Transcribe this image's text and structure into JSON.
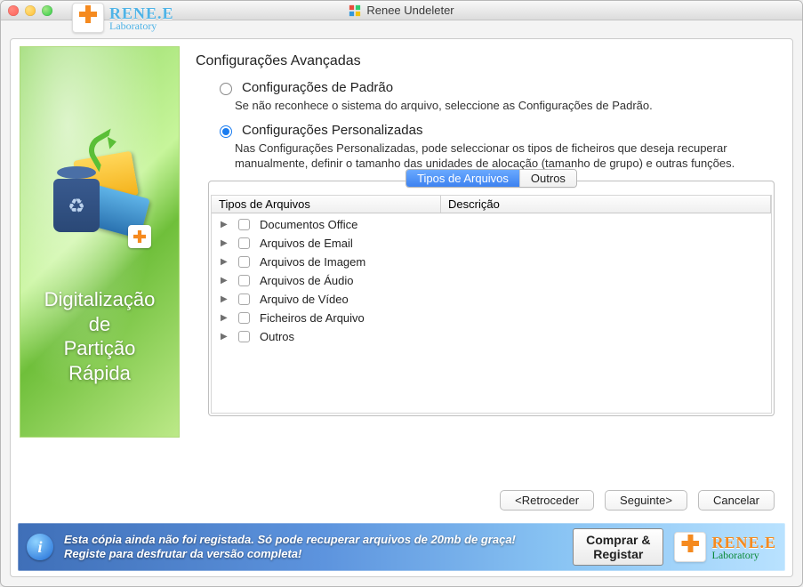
{
  "window": {
    "title": "Renee Undeleter"
  },
  "brand": {
    "name": "RENE.E",
    "sub": "Laboratory"
  },
  "sidebar": {
    "text": "Digitalização\nde\nPartição\nRápida"
  },
  "main": {
    "title": "Configurações Avançadas",
    "opt_default": {
      "label": "Configurações de Padrão",
      "desc": "Se não reconhece o sistema do arquivo, seleccione as Configurações de Padrão."
    },
    "opt_custom": {
      "label": "Configurações Personalizadas",
      "desc": "Nas Configurações Personalizadas, pode seleccionar os tipos de ficheiros que deseja recuperar manualmente, definir o tamanho das unidades de alocação (tamanho de grupo) e outras funções."
    },
    "tabs": {
      "types": "Tipos de Arquivos",
      "others": "Outros"
    },
    "columns": {
      "type": "Tipos de Arquivos",
      "desc": "Descrição"
    },
    "rows": [
      {
        "label": "Documentos Office"
      },
      {
        "label": "Arquivos de Email"
      },
      {
        "label": "Arquivos de Imagem"
      },
      {
        "label": "Arquivos de Áudio"
      },
      {
        "label": "Arquivo de Vídeo"
      },
      {
        "label": "Ficheiros de Arquivo"
      },
      {
        "label": "Outros"
      }
    ]
  },
  "buttons": {
    "back": "<Retroceder",
    "next": "Seguinte>",
    "cancel": "Cancelar"
  },
  "promo": {
    "text": "Esta cópia ainda não foi registada. Só pode recuperar arquivos de 20mb de graça!\nRegiste para desfrutar da versão completa!",
    "buy": "Comprar &\nRegistar"
  }
}
